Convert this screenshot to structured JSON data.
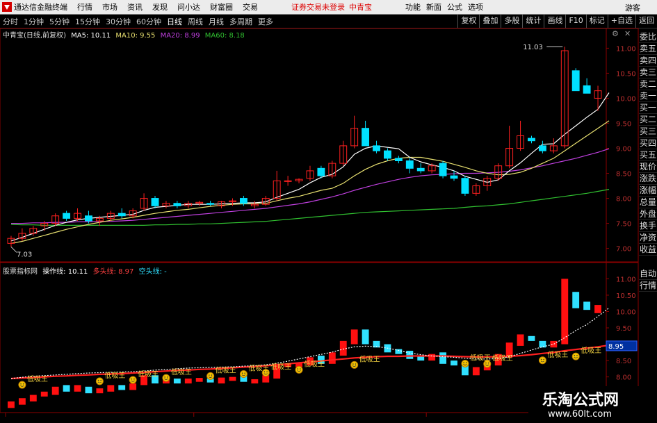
{
  "app": {
    "title": "通达信金融终端"
  },
  "menu": [
    "行情",
    "市场",
    "资讯",
    "发现",
    "问小达",
    "财富圈",
    "交易"
  ],
  "notice": {
    "text": "证券交易未登录",
    "stock": "中青宝"
  },
  "right_menu": [
    "功能",
    "新面",
    "公式",
    "选项"
  ],
  "guest": "游客",
  "periods": [
    "分时",
    "1分钟",
    "5分钟",
    "15分钟",
    "30分钟",
    "60分钟",
    "日线",
    "周线",
    "月线",
    "多周期",
    "更多"
  ],
  "active_period": "日线",
  "tools": [
    "复权",
    "叠加",
    "多股",
    "统计",
    "画线",
    "F10",
    "标记",
    "+自选",
    "返回"
  ],
  "main_legend": {
    "title": "中青宝(日线,前复权)",
    "ma5": "MA5: 10.11",
    "ma10": "MA10: 9.55",
    "ma20": "MA20: 8.99",
    "ma60": "MA60: 8.18"
  },
  "ind_legend": {
    "title": "股票指标网",
    "op": "操作线: 10.11",
    "bull": "多头线: 8.97",
    "bear": "空头线: -"
  },
  "side_panel": [
    "委比",
    "卖五",
    "卖四",
    "卖三",
    "卖二",
    "卖一",
    "买一",
    "买二",
    "买三",
    "买四",
    "买五",
    "现价",
    "涨跌",
    "涨幅",
    "总量",
    "外盘",
    "换手",
    "净资",
    "收益"
  ],
  "side_panel2": [
    "自动",
    "行情"
  ],
  "labels": {
    "hi": "11.03",
    "lo": "7.03",
    "marker": "低吸王",
    "cur": "8.95"
  },
  "colors": {
    "up": "#ff2020",
    "down": "#00e0ff",
    "ma5": "#ffffff",
    "ma10": "#e8e070",
    "ma20": "#c040e0",
    "ma60": "#30c030"
  },
  "watermark": {
    "line1": "乐淘公式网",
    "line2": "www.60lt.com"
  },
  "chart_data": [
    {
      "type": "candlestick",
      "ylim": [
        6.8,
        11.2
      ],
      "yticks": [
        "11.00",
        "10.50",
        "10.00",
        "9.50",
        "9.00",
        "8.50",
        "8.00",
        "7.50",
        "7.00"
      ],
      "ohlc": [
        [
          7.1,
          7.25,
          7.03,
          7.2
        ],
        [
          7.2,
          7.4,
          7.15,
          7.3
        ],
        [
          7.3,
          7.45,
          7.25,
          7.4
        ],
        [
          7.45,
          7.55,
          7.35,
          7.5
        ],
        [
          7.5,
          7.7,
          7.45,
          7.65
        ],
        [
          7.7,
          7.75,
          7.55,
          7.6
        ],
        [
          7.6,
          7.8,
          7.55,
          7.7
        ],
        [
          7.65,
          7.75,
          7.5,
          7.55
        ],
        [
          7.55,
          7.65,
          7.45,
          7.6
        ],
        [
          7.6,
          7.75,
          7.55,
          7.7
        ],
        [
          7.7,
          7.8,
          7.6,
          7.65
        ],
        [
          7.65,
          7.8,
          7.6,
          7.75
        ],
        [
          7.8,
          8.1,
          7.75,
          8.0
        ],
        [
          8.0,
          8.05,
          7.8,
          7.85
        ],
        [
          7.85,
          7.95,
          7.8,
          7.9
        ],
        [
          7.9,
          7.95,
          7.8,
          7.85
        ],
        [
          7.85,
          7.95,
          7.8,
          7.9
        ],
        [
          7.9,
          7.95,
          7.85,
          7.92
        ],
        [
          7.9,
          7.95,
          7.85,
          7.88
        ],
        [
          7.85,
          7.95,
          7.8,
          7.93
        ],
        [
          7.93,
          8.0,
          7.85,
          7.95
        ],
        [
          8.0,
          8.05,
          7.85,
          7.9
        ],
        [
          7.85,
          7.95,
          7.8,
          7.88
        ],
        [
          7.88,
          8.05,
          7.85,
          8.0
        ],
        [
          8.0,
          8.55,
          7.95,
          8.35
        ],
        [
          8.35,
          8.45,
          8.25,
          8.35
        ],
        [
          8.35,
          8.4,
          8.3,
          8.38
        ],
        [
          8.4,
          8.65,
          8.35,
          8.55
        ],
        [
          8.6,
          8.65,
          8.4,
          8.45
        ],
        [
          8.45,
          8.75,
          8.4,
          8.7
        ],
        [
          8.7,
          9.15,
          8.65,
          9.05
        ],
        [
          9.05,
          9.65,
          9.0,
          9.4
        ],
        [
          9.4,
          9.55,
          9.3,
          9.05
        ],
        [
          9.05,
          9.15,
          8.9,
          8.95
        ],
        [
          8.95,
          9.0,
          8.75,
          8.8
        ],
        [
          8.8,
          8.85,
          8.7,
          8.75
        ],
        [
          8.75,
          8.8,
          8.5,
          8.6
        ],
        [
          8.6,
          8.7,
          8.5,
          8.55
        ],
        [
          8.55,
          8.7,
          8.5,
          8.65
        ],
        [
          8.7,
          8.75,
          8.4,
          8.45
        ],
        [
          8.45,
          8.55,
          8.35,
          8.4
        ],
        [
          8.4,
          8.45,
          8.05,
          8.1
        ],
        [
          8.1,
          8.3,
          8.05,
          8.25
        ],
        [
          8.25,
          8.45,
          8.15,
          8.4
        ],
        [
          8.4,
          8.7,
          8.35,
          8.65
        ],
        [
          8.65,
          9.45,
          8.6,
          9.0
        ],
        [
          9.0,
          9.55,
          8.95,
          9.25
        ],
        [
          9.2,
          9.25,
          9.1,
          9.15
        ],
        [
          9.05,
          9.15,
          8.9,
          8.95
        ],
        [
          8.95,
          9.2,
          8.9,
          9.05
        ],
        [
          9.05,
          11.03,
          9.0,
          10.95
        ],
        [
          10.55,
          10.6,
          10.15,
          10.15
        ],
        [
          10.25,
          10.4,
          10.1,
          10.1
        ],
        [
          10.0,
          10.25,
          9.75,
          10.15
        ]
      ],
      "ma5": [
        7.15,
        7.22,
        7.3,
        7.38,
        7.46,
        7.52,
        7.57,
        7.6,
        7.62,
        7.64,
        7.66,
        7.68,
        7.76,
        7.82,
        7.84,
        7.86,
        7.88,
        7.88,
        7.88,
        7.89,
        7.9,
        7.91,
        7.91,
        7.93,
        8.02,
        8.1,
        8.18,
        8.31,
        8.42,
        8.48,
        8.63,
        8.88,
        9.0,
        9.05,
        9.02,
        8.99,
        8.82,
        8.73,
        8.67,
        8.62,
        8.55,
        8.44,
        8.38,
        8.32,
        8.37,
        8.55,
        8.71,
        8.9,
        9.08,
        9.09,
        9.28,
        9.45,
        9.62,
        9.78,
        10.11
      ],
      "ma10": [
        7.1,
        7.14,
        7.2,
        7.26,
        7.32,
        7.38,
        7.43,
        7.48,
        7.52,
        7.56,
        7.59,
        7.62,
        7.66,
        7.7,
        7.73,
        7.76,
        7.78,
        7.81,
        7.84,
        7.86,
        7.88,
        7.89,
        7.89,
        7.9,
        7.95,
        8.0,
        8.04,
        8.1,
        8.16,
        8.2,
        8.3,
        8.45,
        8.58,
        8.68,
        8.75,
        8.8,
        8.82,
        8.82,
        8.78,
        8.74,
        8.68,
        8.62,
        8.55,
        8.5,
        8.47,
        8.48,
        8.52,
        8.6,
        8.7,
        8.8,
        8.95,
        9.1,
        9.25,
        9.4,
        9.55
      ],
      "ma20": [
        7.5,
        7.5,
        7.51,
        7.51,
        7.52,
        7.52,
        7.53,
        7.53,
        7.54,
        7.54,
        7.55,
        7.56,
        7.58,
        7.6,
        7.62,
        7.64,
        7.66,
        7.68,
        7.7,
        7.72,
        7.74,
        7.76,
        7.78,
        7.8,
        7.83,
        7.86,
        7.89,
        7.93,
        7.98,
        8.03,
        8.09,
        8.16,
        8.22,
        8.28,
        8.33,
        8.38,
        8.42,
        8.45,
        8.47,
        8.48,
        8.49,
        8.5,
        8.5,
        8.51,
        8.52,
        8.54,
        8.57,
        8.61,
        8.65,
        8.7,
        8.75,
        8.8,
        8.86,
        8.92,
        8.99
      ],
      "ma60": [
        7.48,
        7.47,
        7.47,
        7.46,
        7.46,
        7.46,
        7.46,
        7.46,
        7.46,
        7.46,
        7.46,
        7.46,
        7.46,
        7.47,
        7.47,
        7.48,
        7.48,
        7.49,
        7.49,
        7.5,
        7.51,
        7.52,
        7.53,
        7.54,
        7.56,
        7.58,
        7.6,
        7.62,
        7.64,
        7.66,
        7.68,
        7.7,
        7.72,
        7.73,
        7.74,
        7.75,
        7.76,
        7.77,
        7.78,
        7.79,
        7.8,
        7.82,
        7.84,
        7.85,
        7.87,
        7.89,
        7.92,
        7.95,
        7.98,
        8.01,
        8.04,
        8.07,
        8.1,
        8.14,
        8.18
      ]
    },
    {
      "type": "line",
      "ylim": [
        7.95,
        11.2
      ],
      "yticks": [
        "11.00",
        "10.50",
        "10.00",
        "9.50",
        "9.00",
        "8.50",
        "8.00"
      ],
      "op": [
        7.95,
        7.99,
        8.02,
        8.04,
        8.06,
        8.08,
        8.1,
        8.12,
        8.13,
        8.14,
        8.15,
        8.16,
        8.18,
        8.21,
        8.23,
        8.25,
        8.27,
        8.28,
        8.29,
        8.3,
        8.31,
        8.33,
        8.34,
        8.37,
        8.42,
        8.48,
        8.55,
        8.62,
        8.69,
        8.76,
        8.85,
        8.92,
        8.94,
        8.93,
        8.88,
        8.81,
        8.73,
        8.68,
        8.64,
        8.62,
        8.6,
        8.57,
        8.55,
        8.55,
        8.56,
        8.62,
        8.72,
        8.82,
        8.92,
        9.0,
        9.2,
        9.42,
        9.6,
        9.85,
        10.11
      ],
      "bull": [
        7.95,
        7.97,
        7.98,
        8.0,
        8.02,
        8.03,
        8.05,
        8.06,
        8.08,
        8.09,
        8.1,
        8.12,
        8.14,
        8.16,
        8.18,
        8.2,
        8.21,
        8.23,
        8.24,
        8.26,
        8.28,
        8.3,
        8.32,
        8.34,
        8.37,
        8.4,
        8.43,
        8.46,
        8.49,
        8.52,
        8.55,
        8.58,
        8.6,
        8.62,
        8.63,
        8.63,
        8.64,
        8.64,
        8.64,
        8.64,
        8.63,
        8.62,
        8.61,
        8.61,
        8.62,
        8.63,
        8.65,
        8.68,
        8.72,
        8.75,
        8.8,
        8.84,
        8.88,
        8.92,
        8.97
      ],
      "markers": [
        1,
        8,
        11,
        14,
        18,
        21,
        23,
        26,
        31,
        41,
        43,
        48,
        51
      ]
    }
  ]
}
